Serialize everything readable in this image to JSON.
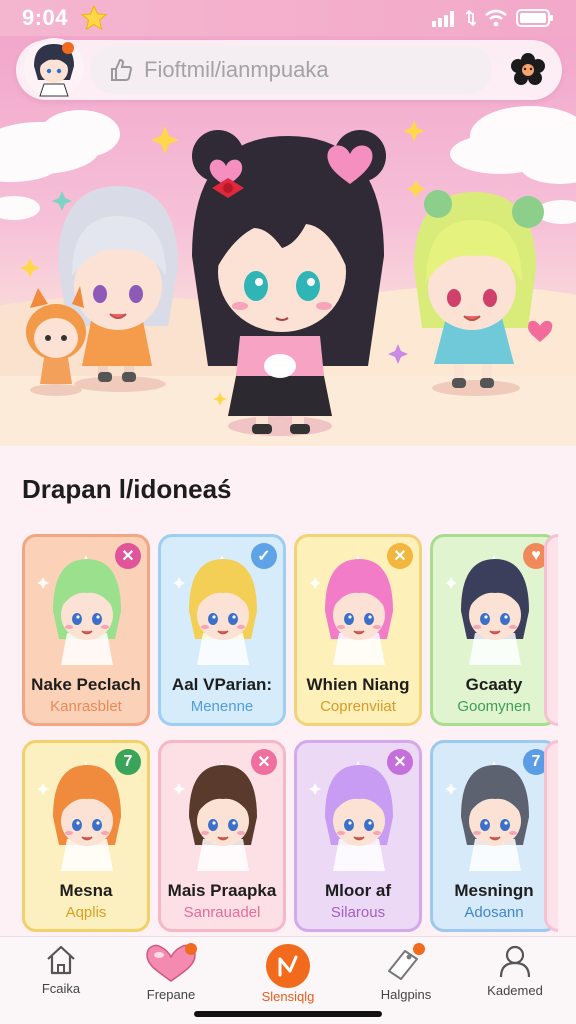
{
  "status": {
    "time": "9:04"
  },
  "search": {
    "placeholder": "Fioftmil/ianmpuaka"
  },
  "section": {
    "title": "Drapan l/idoneaś"
  },
  "cards": [
    {
      "name": "Nake Peclach",
      "sub": "Kanrasblet",
      "badge": "heart",
      "badge_symbol": "✕",
      "badge_color": "#e0559a",
      "sub_color": "#e98a5a",
      "bg": "#fbd2b8",
      "border": "#f2a683",
      "hair": "#9be08c"
    },
    {
      "name": "Aal VParian:",
      "sub": "Menenne",
      "badge": "check",
      "badge_symbol": "✓",
      "badge_color": "#5ea3e6",
      "sub_color": "#4f9fdc",
      "bg": "#d6ecfa",
      "border": "#9ccff2",
      "hair": "#f4cf55"
    },
    {
      "name": "Whien Niang",
      "sub": "Coprenviiat",
      "badge": "close",
      "badge_symbol": "✕",
      "badge_color": "#f2b63f",
      "sub_color": "#d89a2a",
      "bg": "#fdf0b8",
      "border": "#f3d37a",
      "hair": "#f27cc8"
    },
    {
      "name": "Gcaaty",
      "sub": "Goomynen",
      "badge": "heart",
      "badge_symbol": "♥",
      "badge_color": "#f08a5a",
      "sub_color": "#3e9e5a",
      "bg": "#dff4cf",
      "border": "#a9dc8f",
      "hair": "#3b3f5c"
    },
    {
      "name": "Mesna",
      "sub": "Aqplis",
      "badge": "seven",
      "badge_symbol": "7",
      "badge_color": "#3aa55a",
      "sub_color": "#d8a020",
      "bg": "#fdf0c0",
      "border": "#f2d06a",
      "hair": "#f08a3c"
    },
    {
      "name": "Mais Praapka",
      "sub": "Sanrauadel",
      "badge": "close",
      "badge_symbol": "✕",
      "badge_color": "#ef6f9e",
      "sub_color": "#e86a98",
      "bg": "#fde0e6",
      "border": "#f6b8c8",
      "hair": "#5a3a2c"
    },
    {
      "name": "Mloor af",
      "sub": "Silarous",
      "badge": "close",
      "badge_symbol": "✕",
      "badge_color": "#c46fdc",
      "sub_color": "#a35dc4",
      "bg": "#ecd9f6",
      "border": "#d3a9ec",
      "hair": "#c79cf2"
    },
    {
      "name": "Mesningn",
      "sub": "Adosann",
      "badge": "seven",
      "badge_symbol": "7",
      "badge_color": "#5a9de6",
      "sub_color": "#3e86cc",
      "bg": "#d7eaf9",
      "border": "#9ec9ee",
      "hair": "#5d6270"
    }
  ],
  "nav": {
    "items": [
      {
        "label": "Fcaika",
        "icon": "home-icon"
      },
      {
        "label": "Frepane",
        "icon": "heart-icon"
      },
      {
        "label": "Slensiqlg",
        "icon": "bolt-icon"
      },
      {
        "label": "Halgpins",
        "icon": "tag-icon"
      },
      {
        "label": "Kademed",
        "icon": "user-icon"
      }
    ],
    "active": "Slensiqlg",
    "accent": "#f26a1b"
  },
  "colors": {
    "accent_pink": "#f3a9c9",
    "accent_orange": "#f26a1b"
  }
}
